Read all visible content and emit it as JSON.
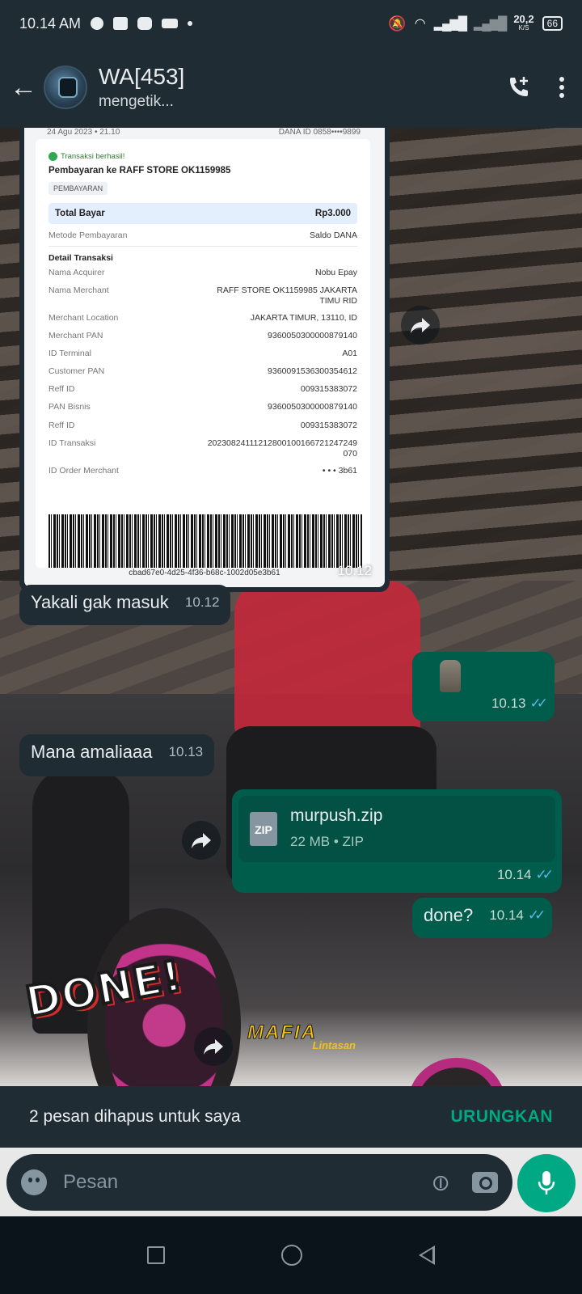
{
  "status_bar": {
    "time": "10.14 AM",
    "speed": "20,2",
    "speed_unit": "K/S",
    "battery": "66"
  },
  "header": {
    "title": "WA[453]",
    "subtitle": "mengetik..."
  },
  "receipt": {
    "date": "24 Agu 2023 • 21.10",
    "dana_id": "DANA ID 0858••••9899",
    "status": "Transaksi berhasil!",
    "title": "Pembayaran ke RAFF STORE OK1159985",
    "tag": "PEMBAYARAN",
    "total_label": "Total Bayar",
    "total_value": "Rp3.000",
    "method_label": "Metode Pembayaran",
    "method_value": "Saldo DANA",
    "detail_title": "Detail Transaksi",
    "rows": [
      {
        "label": "Nama Acquirer",
        "value": "Nobu Epay"
      },
      {
        "label": "Nama Merchant",
        "value": "RAFF STORE OK1159985 JAKARTA TIMU RID"
      },
      {
        "label": "Merchant Location",
        "value": "JAKARTA TIMUR, 13110, ID"
      },
      {
        "label": "Merchant PAN",
        "value": "9360050300000879140"
      },
      {
        "label": "ID Terminal",
        "value": "A01"
      },
      {
        "label": "Customer PAN",
        "value": "9360091536300354612"
      },
      {
        "label": "Reff ID",
        "value": "009315383072"
      },
      {
        "label": "PAN Bisnis",
        "value": "9360050300000879140"
      }
    ],
    "rows2": [
      {
        "label": "Reff ID",
        "value": "009315383072"
      },
      {
        "label": "ID Transaksi",
        "value": "20230824111212800100166721247249 070"
      },
      {
        "label": "ID Order Merchant",
        "value": "• • • 3b61"
      }
    ],
    "barcode_id": "cbad67e0-4d25-4f36-b68c-1002d05e3b61"
  },
  "messages": {
    "image_time": "10.12",
    "m1_text": "Yakali gak masuk",
    "m1_time": "10.12",
    "m2_time": "10.13",
    "m3_text": "Mana amaliaaa",
    "m3_time": "10.13",
    "file_name": "murpush.zip",
    "file_meta": "22 MB • ZIP",
    "file_ext": "ZIP",
    "file_time": "10.14",
    "m5_text": "done?",
    "m5_time": "10.14"
  },
  "wallpaper": {
    "sticker_text": "DONE!",
    "logo_text": "MAFIA",
    "logo_sub": "Lintasan"
  },
  "snackbar": {
    "text": "2 pesan dihapus untuk saya",
    "action": "URUNGKAN"
  },
  "composer": {
    "placeholder": "Pesan"
  },
  "colors": {
    "header_bg": "#1f2c34",
    "outgoing_bubble": "#005c4b",
    "incoming_bubble": "#1f2c34",
    "accent": "#00a884",
    "read_ticks": "#53bdeb"
  }
}
